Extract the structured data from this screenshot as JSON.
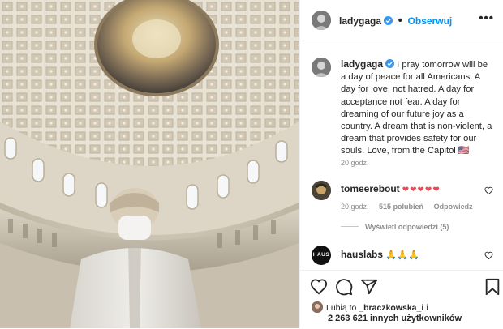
{
  "post": {
    "username": "ladygaga",
    "follow_label": "Obserwuj",
    "more_label": "•••"
  },
  "caption": {
    "username": "ladygaga",
    "text": "I pray tomorrow will be a day of peace for all Americans. A day for love, not hatred. A day for acceptance not fear. A day for dreaming of our future joy as a country. A dream that is non-violent, a dream that provides safety for our souls. Love, from the Capitol",
    "flag_emoji": "🇺🇸",
    "time": "20 godz."
  },
  "comments": [
    {
      "username": "tomeerebout",
      "text": "❤❤❤❤❤",
      "time": "20 godz.",
      "likes": "515 polubień",
      "reply_label": "Odpowiedz",
      "view_replies": "Wyświetl odpowiedzi (5)"
    },
    {
      "username": "hauslabs",
      "avatar_text": "HAUS",
      "text": "🙏🙏🙏"
    }
  ],
  "likes": {
    "liked_by_prefix": "Lubią to",
    "liked_by_user": "_braczkowska_i",
    "others": "2 263 621 innych użytkowników"
  },
  "icons": [
    "heart-icon",
    "comment-icon",
    "share-icon",
    "bookmark-icon",
    "verified-badge-icon",
    "like-comment-icon"
  ],
  "colors": {
    "accent": "#0095f6",
    "verified": "#3897f0",
    "heart_red": "#ed4956",
    "muted": "#8e8e8e"
  }
}
